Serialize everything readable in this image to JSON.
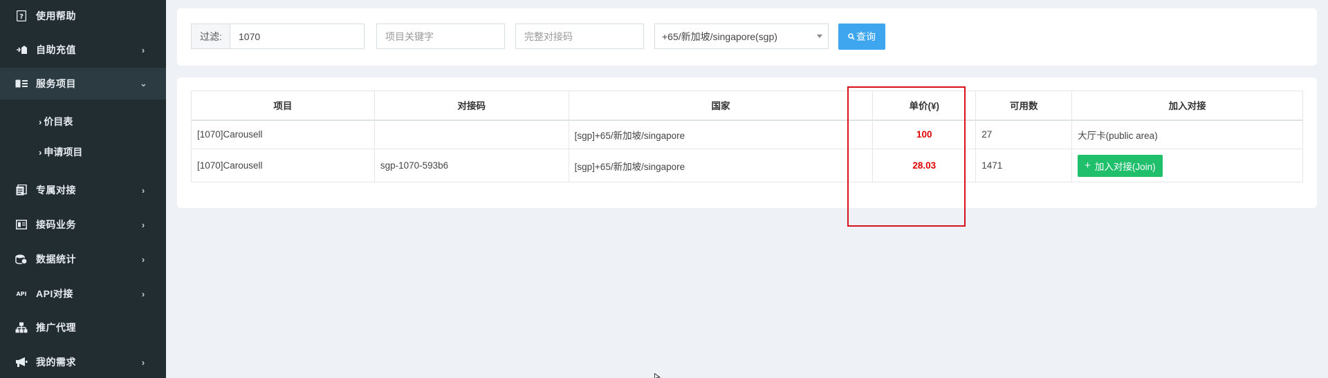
{
  "sidebar": {
    "items": [
      {
        "label": "使用帮助",
        "icon": "help-icon",
        "has_children": false
      },
      {
        "label": "自助充值",
        "icon": "recharge-icon",
        "has_children": true
      },
      {
        "label": "服务项目",
        "icon": "service-icon",
        "has_children": true,
        "expanded": true
      },
      {
        "label": "专属对接",
        "icon": "dedicated-icon",
        "has_children": true
      },
      {
        "label": "接码业务",
        "icon": "code-business-icon",
        "has_children": true
      },
      {
        "label": "数据统计",
        "icon": "statistics-icon",
        "has_children": true
      },
      {
        "label": "API对接",
        "icon": "api-icon",
        "has_children": true
      },
      {
        "label": "推广代理",
        "icon": "promotion-icon",
        "has_children": false
      },
      {
        "label": "我的需求",
        "icon": "megaphone-icon",
        "has_children": true
      }
    ],
    "subitems": [
      {
        "label": "价目表",
        "active": true
      },
      {
        "label": "申请项目",
        "active": false
      }
    ]
  },
  "filter": {
    "label": "过滤:",
    "value": "1070",
    "keyword_placeholder": "项目关键字",
    "code_placeholder": "完整对接码",
    "country_selected": "+65/新加坡/singapore(sgp)",
    "query_label": "查询"
  },
  "table": {
    "headers": [
      "项目",
      "对接码",
      "国家",
      "单价(¥)",
      "可用数",
      "加入对接"
    ],
    "rows": [
      {
        "project": "[1070]Carousell",
        "code": "",
        "country": "[sgp]+65/新加坡/singapore",
        "price": "100",
        "available": "27",
        "join": "大厅卡(public area)"
      },
      {
        "project": "[1070]Carousell",
        "code": "sgp-1070-593b6",
        "country": "[sgp]+65/新加坡/singapore",
        "price": "28.03",
        "available": "1471",
        "join_button": "加入对接(Join)"
      }
    ]
  },
  "colors": {
    "sidebar_bg": "#222d32",
    "query_button": "#3ea6ef",
    "join_button": "#1fbf6c",
    "price_text": "#e00000",
    "highlight_border": "#d8101c"
  }
}
